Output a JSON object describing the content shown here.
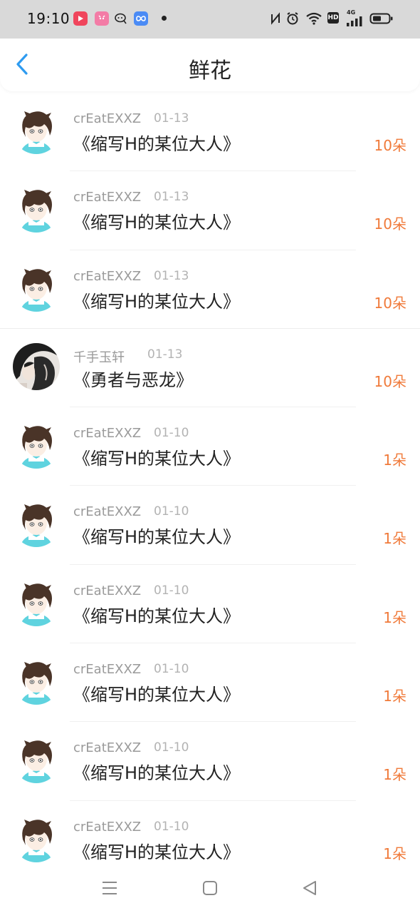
{
  "status_bar": {
    "time": "19:10",
    "hd_label": "HD",
    "network_label": "4G",
    "icons": [
      "video-app-icon",
      "pink-app-icon",
      "chat-app-icon",
      "blue-app-icon",
      "nfc-icon",
      "alarm-icon",
      "wifi-icon",
      "hd-icon",
      "signal-icon",
      "battery-icon"
    ]
  },
  "header": {
    "title": "鲜花",
    "back_icon": "chevron-left-icon"
  },
  "colors": {
    "accent_blue": "#2e9bf0",
    "count_orange": "#f07a3a",
    "status_bar_bg": "#d9d9d9"
  },
  "flowers": [
    {
      "user": "crEatEXXZ",
      "date": "01-13",
      "title": "《缩写H的某位大人》",
      "count": "10朵",
      "avatar": "anime-boy-avatar"
    },
    {
      "user": "crEatEXXZ",
      "date": "01-13",
      "title": "《缩写H的某位大人》",
      "count": "10朵",
      "avatar": "anime-boy-avatar"
    },
    {
      "user": "crEatEXXZ",
      "date": "01-13",
      "title": "《缩写H的某位大人》",
      "count": "10朵",
      "avatar": "anime-boy-avatar"
    },
    {
      "user": "千手玉轩",
      "date": "01-13",
      "title": "《勇者与恶龙》",
      "count": "10朵",
      "avatar": "dark-hair-avatar"
    },
    {
      "user": "crEatEXXZ",
      "date": "01-10",
      "title": "《缩写H的某位大人》",
      "count": "1朵",
      "avatar": "anime-boy-avatar"
    },
    {
      "user": "crEatEXXZ",
      "date": "01-10",
      "title": "《缩写H的某位大人》",
      "count": "1朵",
      "avatar": "anime-boy-avatar"
    },
    {
      "user": "crEatEXXZ",
      "date": "01-10",
      "title": "《缩写H的某位大人》",
      "count": "1朵",
      "avatar": "anime-boy-avatar"
    },
    {
      "user": "crEatEXXZ",
      "date": "01-10",
      "title": "《缩写H的某位大人》",
      "count": "1朵",
      "avatar": "anime-boy-avatar"
    },
    {
      "user": "crEatEXXZ",
      "date": "01-10",
      "title": "《缩写H的某位大人》",
      "count": "1朵",
      "avatar": "anime-boy-avatar"
    },
    {
      "user": "crEatEXXZ",
      "date": "01-10",
      "title": "《缩写H的某位大人》",
      "count": "1朵",
      "avatar": "anime-boy-avatar"
    }
  ],
  "nav": {
    "icons": [
      "menu-icon",
      "home-square-icon",
      "back-triangle-icon"
    ]
  }
}
